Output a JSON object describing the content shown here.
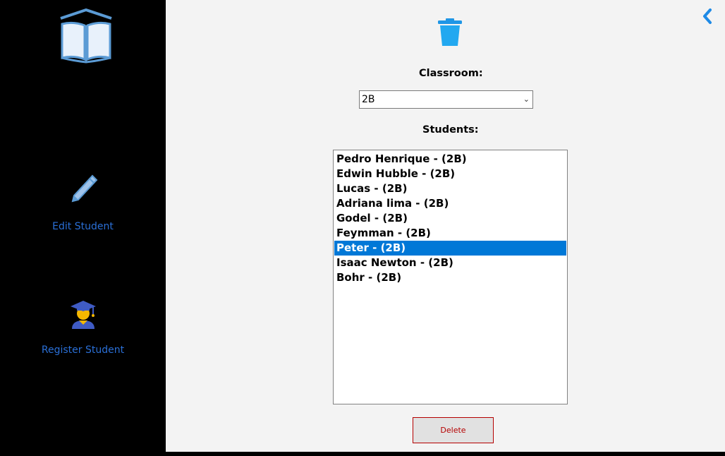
{
  "sidebar": {
    "logo_icon": "open-book-icon",
    "items": [
      {
        "label": "Edit Student",
        "icon": "pencil-icon"
      },
      {
        "label": "Register Student",
        "icon": "graduate-student-icon"
      }
    ]
  },
  "header": {
    "back_icon": "chevron-left-icon",
    "title_icon": "trash-can-icon"
  },
  "form": {
    "classroom_label": "Classroom:",
    "classroom_value": "2B",
    "students_label": "Students:",
    "students": [
      "Pedro Henrique - (2B)",
      "Edwin Hubble - (2B)",
      "Lucas - (2B)",
      "Adriana lima - (2B)",
      "Godel - (2B)",
      "Feymman - (2B)",
      "Peter - (2B)",
      "Isaac Newton - (2B)",
      "Bohr - (2B)"
    ],
    "selected_index": 6,
    "delete_label": "Delete"
  },
  "colors": {
    "sidebar_bg": "#000000",
    "main_bg": "#f3f3f3",
    "accent": "#2a6fd6",
    "selection": "#0078d7",
    "delete_text": "#b50000"
  }
}
